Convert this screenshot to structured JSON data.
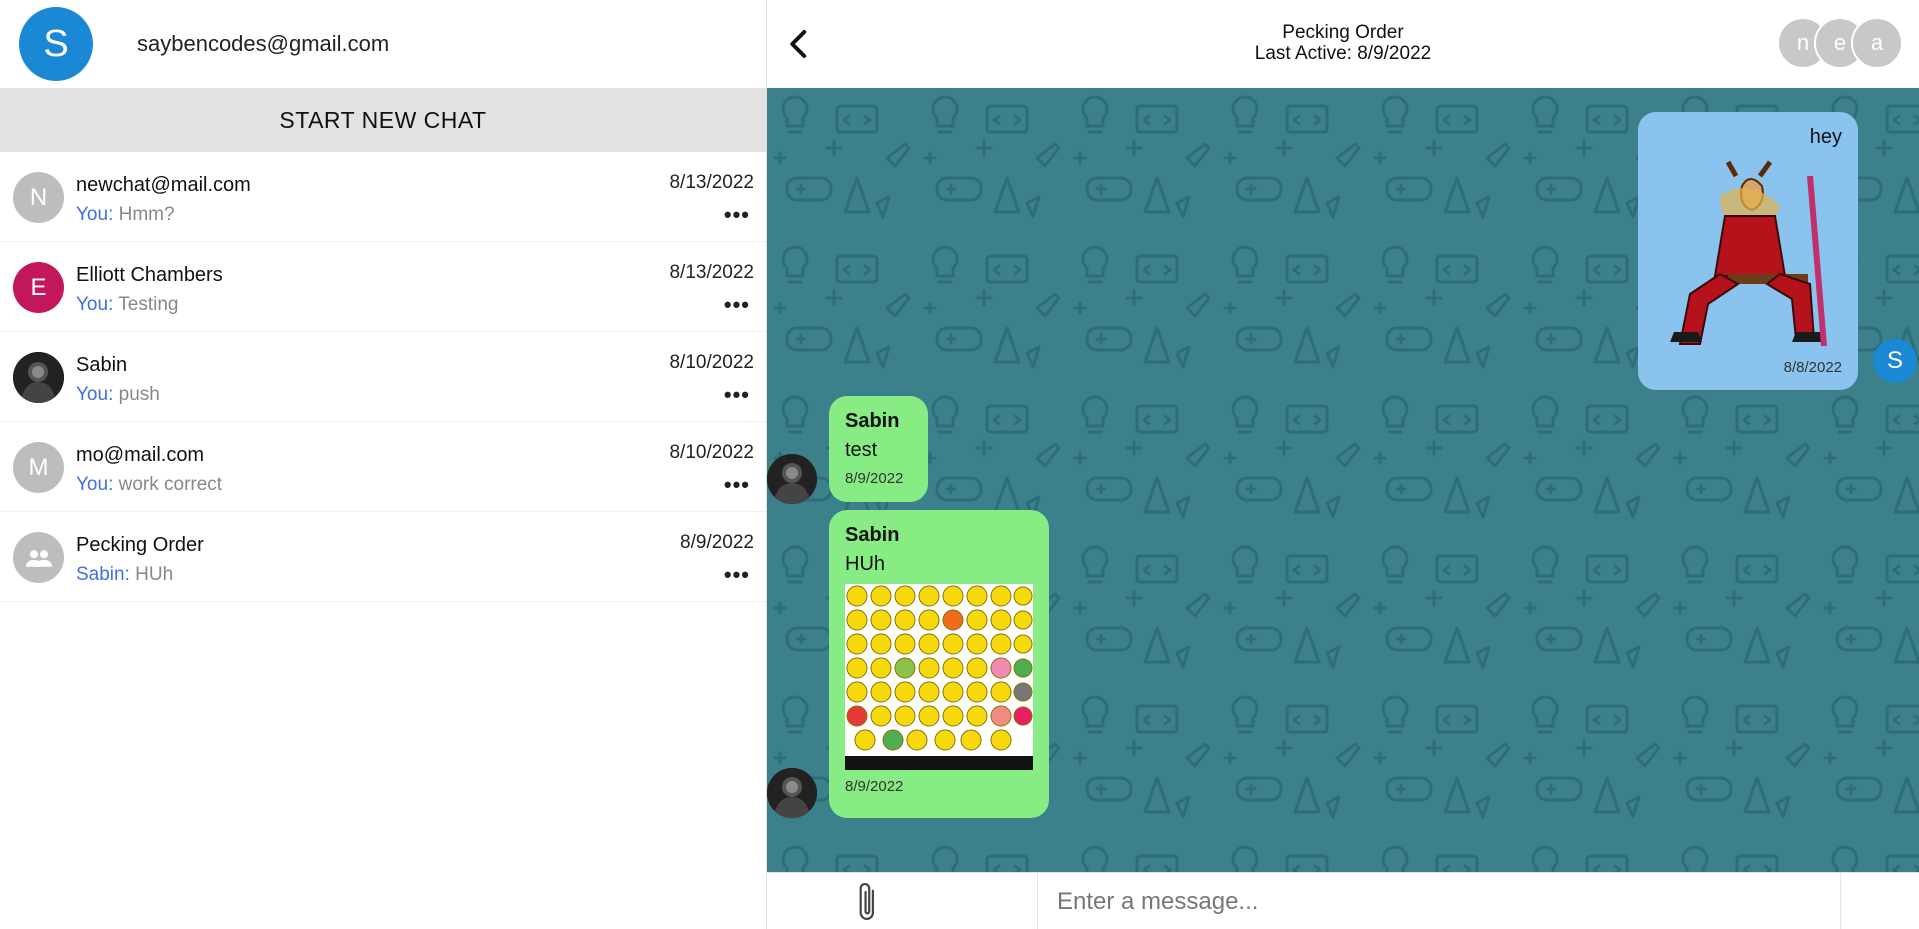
{
  "profile": {
    "initial": "S",
    "email": "saybencodes@gmail.com"
  },
  "sidebar": {
    "new_chat_label": "START NEW CHAT"
  },
  "chats": [
    {
      "initial": "N",
      "name": "newchat@mail.com",
      "who": "You:",
      "preview": "Hmm?",
      "date": "8/13/2022",
      "more": "•••"
    },
    {
      "initial": "E",
      "name": "Elliott Chambers",
      "who": "You:",
      "preview": "Testing",
      "date": "8/13/2022",
      "more": "•••"
    },
    {
      "initial": "",
      "name": "Sabin",
      "who": "You:",
      "preview": "push",
      "date": "8/10/2022",
      "more": "•••"
    },
    {
      "initial": "M",
      "name": "mo@mail.com",
      "who": "You:",
      "preview": "work correct",
      "date": "8/10/2022",
      "more": "•••"
    },
    {
      "initial": "",
      "name": "Pecking Order",
      "who": "Sabin:",
      "preview": "HUh",
      "date": "8/9/2022",
      "more": "•••"
    }
  ],
  "conversation": {
    "title": "Pecking Order",
    "last_active": "Last Active: 8/9/2022",
    "members": [
      "n",
      "e",
      "a"
    ],
    "messages": [
      {
        "sender": "",
        "text": "hey",
        "time": "8/8/2022",
        "avatar": "S"
      },
      {
        "sender": "Sabin",
        "text": "test",
        "time": "8/9/2022"
      },
      {
        "sender": "Sabin",
        "text": "HUh",
        "time": "8/9/2022"
      }
    ],
    "input_placeholder": "Enter a message..."
  },
  "colors": {
    "accent": "#1a88d4",
    "chat_bg": "#3b808b",
    "mine_bubble": "#8ac4ee",
    "their_bubble": "#88ec84",
    "you_label": "#3f6fe0"
  }
}
